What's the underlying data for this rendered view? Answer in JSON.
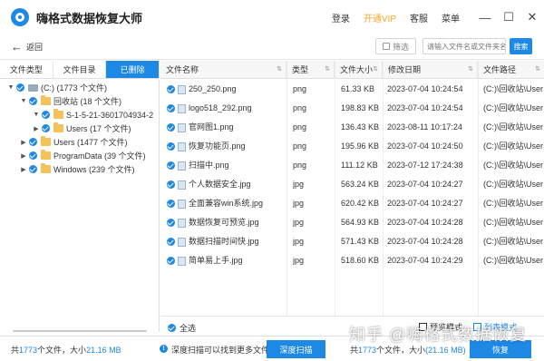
{
  "app": {
    "title": "嗨格式数据恢复大师",
    "login": "登录",
    "vip": "开通VIP",
    "service": "客服",
    "menu": "菜单"
  },
  "toolbar": {
    "back": "返回",
    "filter": "筛选",
    "search_placeholder": "请输入文件名或文件夹名",
    "search_btn": "搜索"
  },
  "left_tabs": [
    "文件类型",
    "文件目录",
    "已删除"
  ],
  "tree": [
    {
      "label": "(C:) (1773 个文件)"
    },
    {
      "label": "回收站 (18 个文件)"
    },
    {
      "label": "S-1-5-21-3601704934-2"
    },
    {
      "label": "Users (17 个文件)"
    },
    {
      "label": "Users (1477 个文件)"
    },
    {
      "label": "ProgramData (39 个文件)"
    },
    {
      "label": "Windows (239 个文件)"
    }
  ],
  "table": {
    "headers": [
      "文件名称",
      "类型",
      "文件大小",
      "修改日期",
      "文件路径"
    ],
    "rows": [
      {
        "name": "250_250.png",
        "type": "png",
        "size": "61.33 KB",
        "date": "2023-07-04 10:24:54",
        "path": "(C:)\\回收站\\Users\\..."
      },
      {
        "name": "logo518_292.png",
        "type": "png",
        "size": "198.83 KB",
        "date": "2023-07-04 10:24:54",
        "path": "(C:)\\回收站\\Users\\..."
      },
      {
        "name": "官网图1.png",
        "type": "png",
        "size": "136.43 KB",
        "date": "2023-08-11 10:17:24",
        "path": "(C:)\\回收站\\Users\\..."
      },
      {
        "name": "恢复功能页.png",
        "type": "png",
        "size": "195.96 KB",
        "date": "2023-07-04 10:24:50",
        "path": "(C:)\\回收站\\Users\\..."
      },
      {
        "name": "扫描中.png",
        "type": "png",
        "size": "111.12 KB",
        "date": "2023-07-12 17:24:38",
        "path": "(C:)\\回收站\\Users\\..."
      },
      {
        "name": "个人数据安全.jpg",
        "type": "jpg",
        "size": "563.24 KB",
        "date": "2023-07-04 10:24:27",
        "path": "(C:)\\回收站\\Users\\..."
      },
      {
        "name": "全面兼容win系统.jpg",
        "type": "jpg",
        "size": "620.42 KB",
        "date": "2023-07-04 10:24:27",
        "path": "(C:)\\回收站\\Users\\..."
      },
      {
        "name": "数据恢复可预览.jpg",
        "type": "jpg",
        "size": "564.93 KB",
        "date": "2023-07-04 10:24:28",
        "path": "(C:)\\回收站\\Users\\..."
      },
      {
        "name": "数据扫描时间快.jpg",
        "type": "jpg",
        "size": "571.43 KB",
        "date": "2023-07-04 10:24:28",
        "path": "(C:)\\回收站\\Users\\..."
      },
      {
        "name": "简单易上手.jpg",
        "type": "jpg",
        "size": "518.60 KB",
        "date": "2023-07-04 10:24:29",
        "path": "(C:)\\回收站\\Users\\..."
      }
    ]
  },
  "bottom": {
    "select_all": "全选",
    "preview_mode": "预览模式",
    "list_mode": "列表模式"
  },
  "footer": {
    "total_prefix": "共",
    "total_count": "1773",
    "total_mid": "个文件，大小",
    "total_size": "21.16 MB",
    "tip": "深度扫描可以找到更多文件",
    "deep_scan": "深度扫描",
    "sel_prefix": "共",
    "sel_count": "1773",
    "sel_mid": "个文件，大小",
    "sel_size": "(21.16 MB)",
    "recover": "恢复"
  },
  "watermark": "知乎 @嗨格式数据恢复"
}
